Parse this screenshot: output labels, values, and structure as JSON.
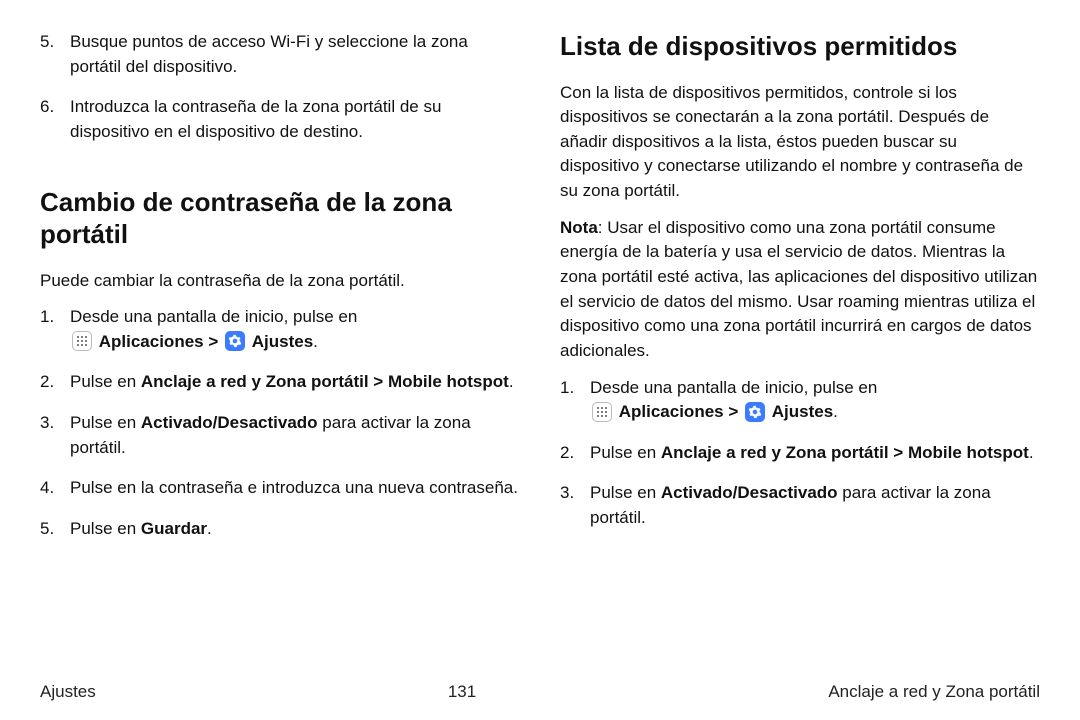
{
  "labels": {
    "aplicaciones": "Aplicaciones",
    "ajustes": "Ajustes"
  },
  "left": {
    "cont_5": "Busque puntos de acceso Wi-Fi y seleccione la zona portátil del dispositivo.",
    "cont_6": "Introduzca la contraseña de la zona portátil de su dispositivo en el dispositivo de destino.",
    "heading": "Cambio de contraseña de la zona portátil",
    "intro": "Puede cambiar la contraseña de la zona portátil.",
    "s1_a": "Desde una pantalla de inicio, pulse en",
    "s2_a": "Pulse en ",
    "s2_b": "Anclaje a red y Zona portátil",
    "s2_c": "Mobile hotspot",
    "s3_a": "Pulse en ",
    "s3_b": "Activado/Desactivado",
    "s3_c": " para activar la zona portátil.",
    "s4": "Pulse en la contraseña e introduzca una nueva contraseña.",
    "s5_a": "Pulse en ",
    "s5_b": "Guardar"
  },
  "right": {
    "heading": "Lista de dispositivos permitidos",
    "para1": "Con la lista de dispositivos permitidos, controle si los dispositivos se conectarán a la zona portátil. Después de añadir dispositivos a la lista, éstos pueden buscar su dispositivo y conectarse utilizando el nombre y contraseña de su zona portátil.",
    "nota_label": "Nota",
    "nota_body": ": Usar el dispositivo como una zona portátil consume energía de la batería y usa el servicio de datos. Mientras la zona portátil esté activa, las aplicaciones del dispositivo utilizan el servicio de datos del mismo. Usar roaming mientras utiliza el dispositivo como una zona portátil incurrirá en cargos de datos adicionales.",
    "s1_a": "Desde una pantalla de inicio, pulse en",
    "s2_a": "Pulse en ",
    "s2_b": "Anclaje a red y Zona portátil",
    "s2_c": "Mobile hotspot",
    "s3_a": "Pulse en ",
    "s3_b": "Activado/Desactivado",
    "s3_c": " para activar la zona portátil."
  },
  "footer": {
    "left": "Ajustes",
    "center": "131",
    "right": "Anclaje a red y Zona portátil"
  }
}
